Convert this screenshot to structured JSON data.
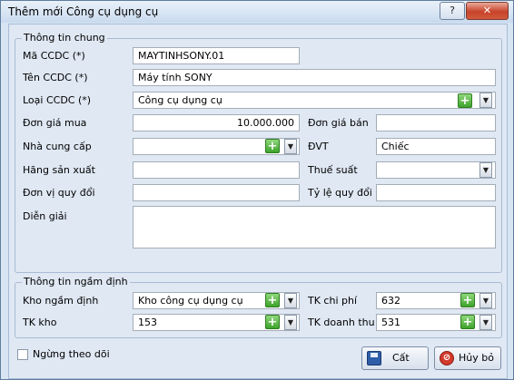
{
  "window": {
    "title": "Thêm mới Công cụ dụng cụ",
    "help_label": "?",
    "close_label": "✕"
  },
  "general": {
    "title": "Thông tin chung",
    "ma_ccdc_label": "Mã CCDC (*)",
    "ma_ccdc_value": "MAYTINHSONY.01",
    "ten_ccdc_label": "Tên CCDC (*)",
    "ten_ccdc_value": "Máy tính SONY",
    "loai_ccdc_label": "Loại CCDC (*)",
    "loai_ccdc_value": "Công cụ dụng cụ",
    "don_gia_mua_label": "Đơn giá mua",
    "don_gia_mua_value": "10.000.000",
    "don_gia_ban_label": "Đơn giá bán",
    "don_gia_ban_value": "",
    "nha_cung_cap_label": "Nhà cung cấp",
    "nha_cung_cap_value": "",
    "dvt_label": "ĐVT",
    "dvt_value": "Chiếc",
    "hang_san_xuat_label": "Hãng sản xuất",
    "hang_san_xuat_value": "",
    "thue_suat_label": "Thuế suất",
    "thue_suat_value": "",
    "don_vi_quy_doi_label": "Đơn vị quy đổi",
    "don_vi_quy_doi_value": "",
    "ty_le_quy_doi_label": "Tỷ lệ quy đổi",
    "ty_le_quy_doi_value": "",
    "dien_giai_label": "Diễn giải",
    "dien_giai_value": ""
  },
  "defaults": {
    "title": "Thông tin ngầm định",
    "kho_label": "Kho ngầm định",
    "kho_value": "Kho công cụ dụng cụ",
    "tk_chi_phi_label": "TK chi phí",
    "tk_chi_phi_value": "632",
    "tk_kho_label": "TK kho",
    "tk_kho_value": "153",
    "tk_doanh_thu_label": "TK doanh thu",
    "tk_doanh_thu_value": "531"
  },
  "footer": {
    "ngung_theo_doi_label": "Ngừng theo dõi",
    "save_label": "Cất",
    "cancel_label": "Hủy bỏ"
  },
  "icons": {
    "add": "+",
    "dropdown": "▼"
  },
  "colors": {
    "window_bg": "#d7e4f2",
    "add_green": "#3ea22b",
    "close_red": "#c8432a"
  }
}
